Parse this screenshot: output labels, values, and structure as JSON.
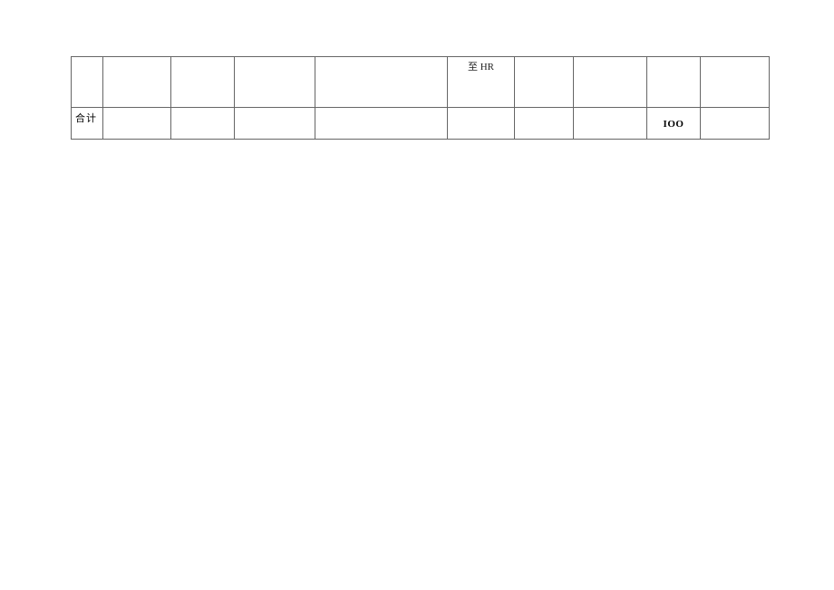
{
  "table": {
    "rows": [
      {
        "cells": [
          "",
          "",
          "",
          "",
          "",
          "至 HR",
          "",
          "",
          "",
          ""
        ]
      },
      {
        "cells": [
          "合计",
          "",
          "",
          "",
          "",
          "",
          "",
          "",
          "IOO",
          ""
        ]
      }
    ]
  }
}
